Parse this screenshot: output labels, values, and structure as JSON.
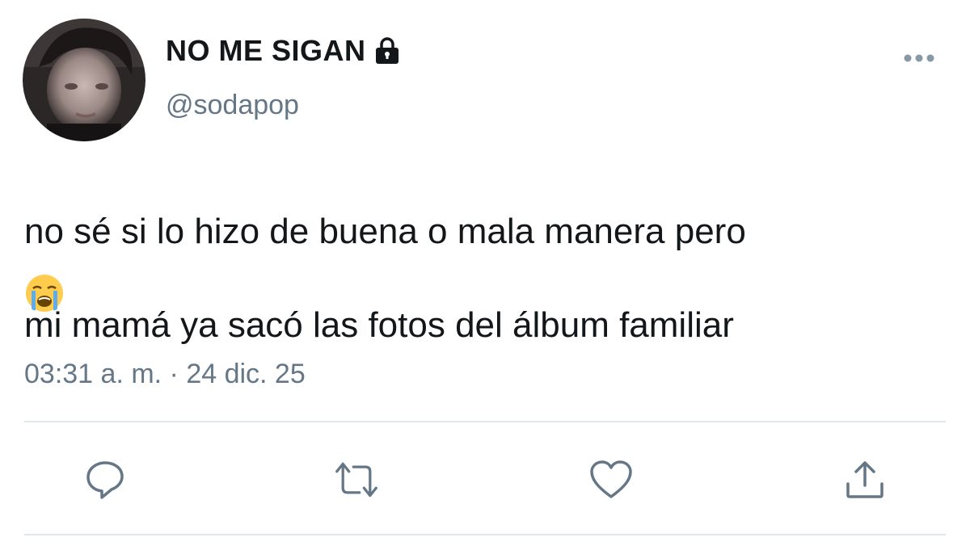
{
  "tweet": {
    "display_name": "NO ME SIGAN",
    "username": "@sodapop",
    "text_line1": " no sé si lo hizo de buena o mala manera pero",
    "text_line2": "mi mamá ya sacó las fotos del álbum familiar",
    "emoji": "😭",
    "timestamp": "03:31 a. m. · 24 dic. 25",
    "protected_icon": "lock-icon",
    "accent_color": "#657786"
  },
  "actions": {
    "reply_icon": "speech-bubble-icon",
    "retweet_icon": "retweet-arrows-icon",
    "like_icon": "heart-icon",
    "share_icon": "share-upload-icon"
  }
}
